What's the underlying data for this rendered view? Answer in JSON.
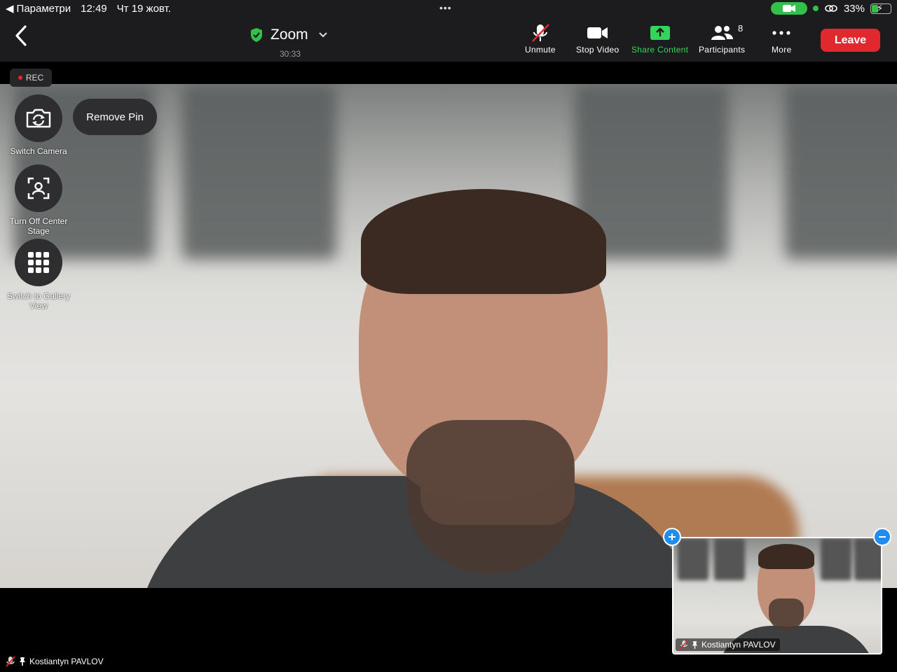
{
  "status_bar": {
    "back_app": "Параметри",
    "time": "12:49",
    "date": "Чт 19 жовт.",
    "more_dots": "•••",
    "battery_percent": "33%",
    "battery_level": 0.33
  },
  "toolbar": {
    "meeting_title": "Zoom",
    "meeting_timer": "30:33",
    "buttons": {
      "unmute": "Unmute",
      "stop_video": "Stop Video",
      "share_content": "Share Content",
      "participants": "Participants",
      "participants_count": "8",
      "more": "More",
      "leave": "Leave"
    },
    "colors": {
      "share_accent": "#33d65a",
      "leave": "#e0282e",
      "shield": "#32c04a"
    }
  },
  "recording": {
    "label": "REC"
  },
  "side_controls": {
    "switch_camera": "Switch Camera",
    "remove_pin": "Remove Pin",
    "center_stage": "Turn Off Center Stage",
    "gallery_view": "Switch to Gallery View"
  },
  "main_video": {
    "participant_name": "Kostiantyn PAVLOV"
  },
  "pip_video": {
    "participant_name": "Kostiantyn PAVLOV"
  }
}
